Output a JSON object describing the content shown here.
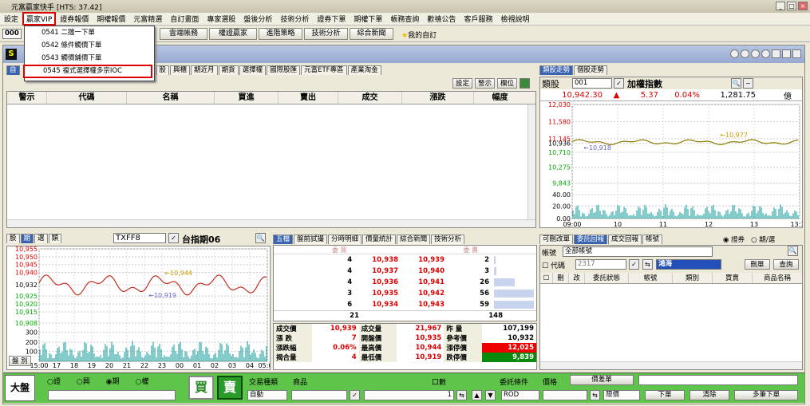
{
  "window": {
    "title": "元富贏家快手 [HTS: 37.42]"
  },
  "menu": {
    "items": [
      "設定",
      "贏家VIP",
      "證券報價",
      "期權報價",
      "元富精選",
      "自訂畫面",
      "專家選股",
      "盤後分析",
      "技術分析",
      "證券下單",
      "期權下單",
      "帳務查詢",
      "歡禧公告",
      "客戶服務",
      "檢視說明"
    ]
  },
  "dropdown": {
    "items": [
      "0541 二擋一下單",
      "0542 條件觸價下單",
      "0543 觸價鋪價下單",
      "0545 複式選擇權多宗IOC"
    ]
  },
  "toolbar": {
    "code": "000",
    "buttons": [
      "雲端帳務",
      "權證贏家",
      "進階策略",
      "技術分析",
      "綜合新聞"
    ],
    "fav": "我的自訂"
  },
  "stocklist": {
    "tabs": [
      "自",
      "股",
      "興櫃",
      "期近月",
      "期貨",
      "選擇權",
      "國際股匯",
      "元富ETF專區",
      "產業淘金"
    ],
    "actions": [
      "設定",
      "警示",
      "欄位"
    ],
    "columns": [
      "警示",
      "代碼",
      "名稱",
      "買進",
      "賣出",
      "成交",
      "漲跌",
      "幅度"
    ]
  },
  "index": {
    "tabs": [
      "類股走勢",
      "個股走勢"
    ],
    "label": "類股",
    "code": "001",
    "name": "加權指數",
    "price": "10,942.30",
    "arrow": "▲",
    "change": "5.37",
    "pct": "0.04%",
    "volume": "1,281.75",
    "unit": "億",
    "yaxis": [
      "12,030",
      "11,580",
      "11,145",
      "10,936",
      "10,710",
      "10,275",
      "9,843",
      "40.00",
      "20.00",
      "0.00"
    ],
    "xaxis": [
      "09:00",
      "10",
      "11",
      "12",
      "13",
      "13:30"
    ],
    "hi_label": "10,977",
    "lo_label": "10,918"
  },
  "futures": {
    "tabs": [
      "股",
      "期",
      "選",
      "類"
    ],
    "code": "TXFF8",
    "name": "台指期06",
    "yaxis": [
      "10,955",
      "10,950",
      "10,945",
      "10,940",
      "10,932",
      "10,925",
      "10,920",
      "10,915",
      "10,908",
      "300",
      "200",
      "100"
    ],
    "xaxis": [
      "15:00",
      "17",
      "18",
      "19",
      "20",
      "21",
      "22",
      "23",
      "00",
      "01",
      "02",
      "03",
      "04",
      "05:00"
    ],
    "hi_label": "10,944",
    "lo_label": "10,919",
    "side_btn": "盤 別"
  },
  "book": {
    "tabs": [
      "五檔",
      "盤前試撮",
      "分時明細",
      "價量統計",
      "綜合新聞",
      "技術分析"
    ],
    "head_bid": "委 買",
    "head_ask": "委 賣",
    "rows": [
      {
        "bq": "4",
        "bid": "10,938",
        "ask": "10,939",
        "aq": "2"
      },
      {
        "bq": "4",
        "bid": "10,937",
        "ask": "10,940",
        "aq": "3"
      },
      {
        "bq": "4",
        "bid": "10,936",
        "ask": "10,941",
        "aq": "26"
      },
      {
        "bq": "3",
        "bid": "10,935",
        "ask": "10,942",
        "aq": "56"
      },
      {
        "bq": "6",
        "bid": "10,934",
        "ask": "10,943",
        "aq": "59"
      }
    ],
    "bid_total": "21",
    "ask_total": "148",
    "summary": [
      [
        "成交價",
        "10,939",
        "成交量",
        "21,967",
        "昨 量",
        "107,199"
      ],
      [
        "漲 跌",
        "7",
        "開盤價",
        "10,935",
        "參考價",
        "10,932"
      ],
      [
        "漲跌幅",
        "0.06%",
        "最高價",
        "10,944",
        "漲停價",
        "12,025"
      ],
      [
        "揭合量",
        "4",
        "最低價",
        "10,919",
        "跌停價",
        "9,839"
      ]
    ]
  },
  "orders": {
    "tabs": [
      "可刪改單",
      "委託回報",
      "成交回報",
      "帳號"
    ],
    "radio": [
      "證券",
      "期/選"
    ],
    "account_label": "帳號",
    "account": "全部帳號",
    "code_label": "代碼",
    "code": "2317",
    "name": "鴻海",
    "btns": [
      "刪單",
      "查詢"
    ],
    "columns": [
      "刪",
      "改",
      "委託狀態",
      "帳號",
      "類別",
      "買賣",
      "商品名稱"
    ]
  },
  "order_bar": {
    "title": "大盤",
    "radios": [
      "證",
      "興",
      "期",
      "權"
    ],
    "buy": "買",
    "sell": "賣",
    "type_label": "交易種類",
    "type": "自動",
    "product_label": "商品",
    "qty_label": "口數",
    "qty": "1",
    "cond_label": "委託條件",
    "cond": "ROD",
    "price_label": "價格",
    "spread_btn": "價差單",
    "price_type": "限價",
    "btns": [
      "下單",
      "清除",
      "多筆下單"
    ]
  }
}
